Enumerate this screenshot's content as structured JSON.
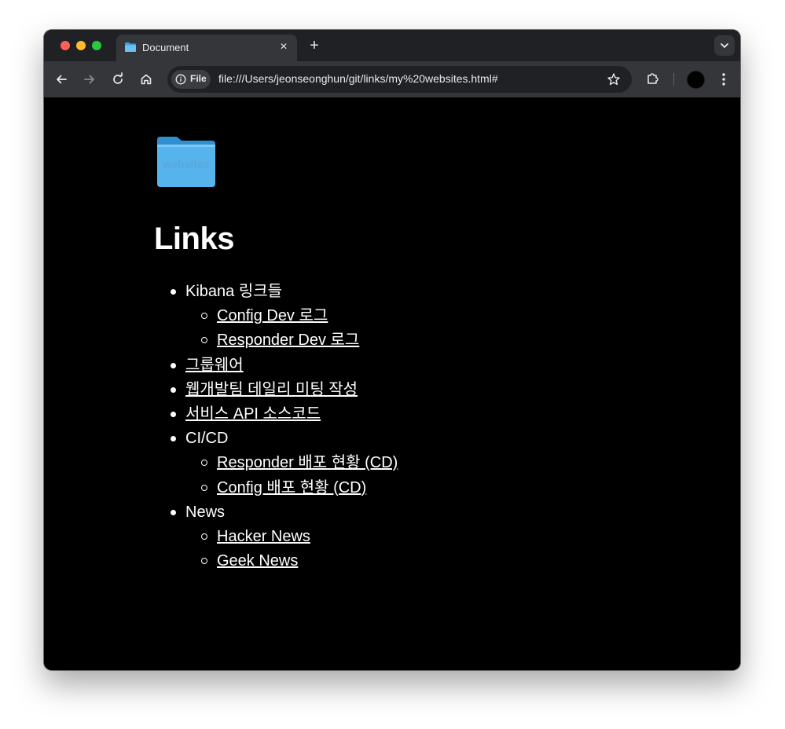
{
  "browser": {
    "tab_title": "Document",
    "tab_close": "×",
    "new_tab": "+",
    "security_chip": "File",
    "url": "file:///Users/jeonseonghun/git/links/my%20websites.html#"
  },
  "page": {
    "logo_text": "websites",
    "title": "Links",
    "items": [
      {
        "label": "Kibana 링크들",
        "link": false,
        "level": 1
      },
      {
        "label": "Config Dev 로그",
        "link": true,
        "level": 2
      },
      {
        "label": "Responder Dev 로그",
        "link": true,
        "level": 2
      },
      {
        "label": "그룹웨어",
        "link": true,
        "level": 1
      },
      {
        "label": "웹개발팀 데일리 미팅 작성",
        "link": true,
        "level": 1
      },
      {
        "label": "서비스 API 소스코드",
        "link": true,
        "level": 1
      },
      {
        "label": "CI/CD",
        "link": false,
        "level": 1
      },
      {
        "label": "Responder 배포 현황 (CD)",
        "link": true,
        "level": 2
      },
      {
        "label": "Config 배포 현황 (CD)",
        "link": true,
        "level": 2
      },
      {
        "label": "News",
        "link": false,
        "level": 1
      },
      {
        "label": "Hacker News",
        "link": true,
        "level": 2
      },
      {
        "label": "Geek News",
        "link": true,
        "level": 2
      }
    ]
  },
  "colors": {
    "link": "#9fd4ee",
    "background": "#000000",
    "folder": "#4aa6e0"
  }
}
